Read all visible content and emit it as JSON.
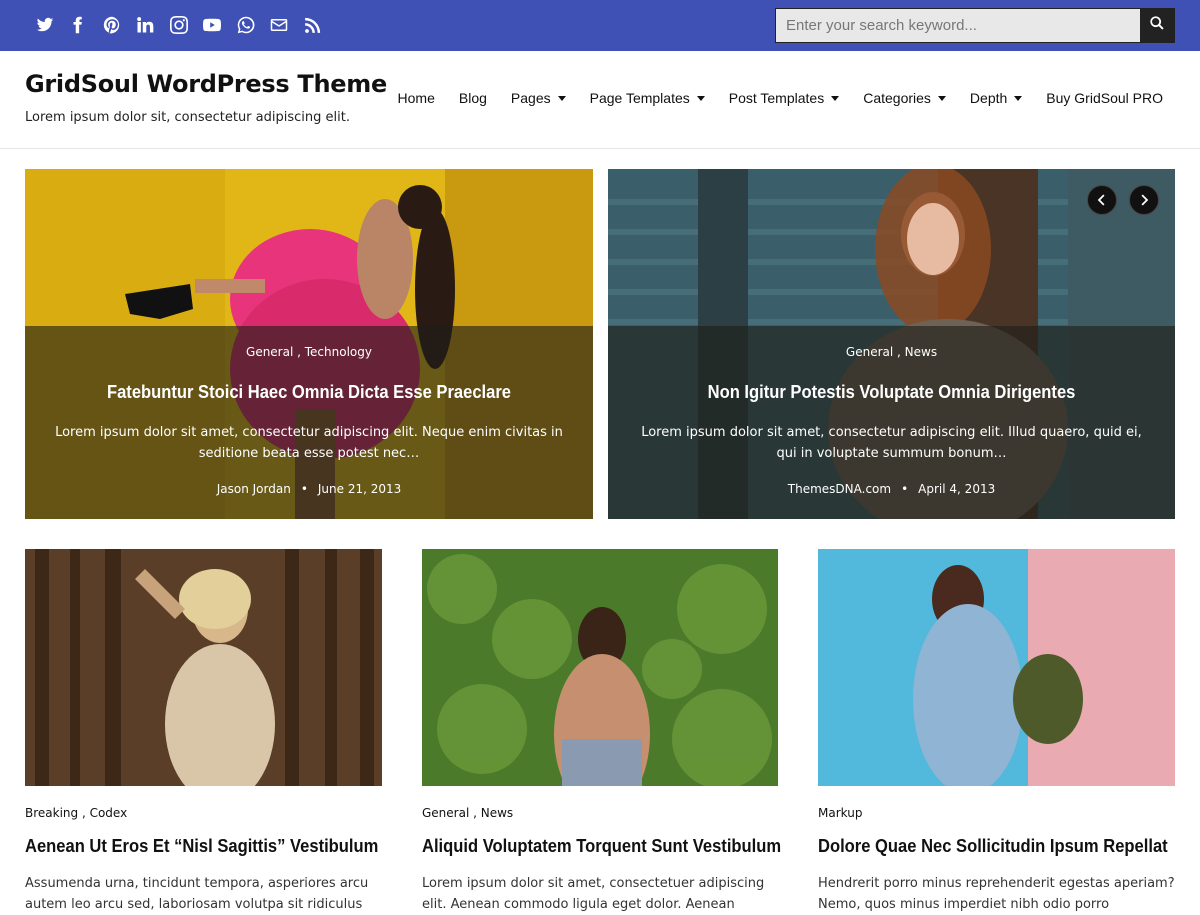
{
  "colors": {
    "topbar": "#3f51b5",
    "accent": "#111111"
  },
  "social_icons": [
    "twitter-icon",
    "facebook-icon",
    "pinterest-icon",
    "linkedin-icon",
    "instagram-icon",
    "youtube-icon",
    "whatsapp-icon",
    "email-icon",
    "rss-icon"
  ],
  "search": {
    "placeholder": "Enter your search keyword..."
  },
  "site": {
    "title": "GridSoul WordPress Theme",
    "description": "Lorem ipsum dolor sit, consectetur adipiscing elit."
  },
  "nav": {
    "items": [
      {
        "label": "Home",
        "dropdown": false
      },
      {
        "label": "Blog",
        "dropdown": false
      },
      {
        "label": "Pages",
        "dropdown": true
      },
      {
        "label": "Page Templates",
        "dropdown": true
      },
      {
        "label": "Post Templates",
        "dropdown": true
      },
      {
        "label": "Categories",
        "dropdown": true
      },
      {
        "label": "Depth",
        "dropdown": true
      },
      {
        "label": "Buy GridSoul PRO",
        "dropdown": false
      }
    ]
  },
  "slider": {
    "slides": [
      {
        "categories": "General , Technology",
        "title": "Fatebuntur Stoici Haec Omnia Dicta Esse Praeclare",
        "excerpt": "Lorem ipsum dolor sit amet, consectetur adipiscing elit. Neque enim civitas in seditione beata esse potest nec…",
        "author": "Jason Jordan",
        "date": "June 21, 2013"
      },
      {
        "categories": "General , News",
        "title": "Non Igitur Potestis Voluptate Omnia Dirigentes",
        "excerpt": "Lorem ipsum dolor sit amet, consectetur adipiscing elit. Illud quaero, quid ei, qui in voluptate summum bonum…",
        "author": "ThemesDNA.com",
        "date": "April 4, 2013"
      }
    ],
    "separator": "•"
  },
  "posts": [
    {
      "categories": "Breaking , Codex",
      "title": "Aenean Ut Eros Et “Nisl Sagittis” Vestibulum",
      "excerpt": "Assumenda urna, tincidunt tempora, asperiores arcu autem leo arcu sed, laboriosam volutpa sit ridiculus"
    },
    {
      "categories": "General , News",
      "title": "Aliquid Voluptatem Torquent Sunt Vestibulum",
      "excerpt": "Lorem ipsum dolor sit amet, consectetuer adipiscing elit. Aenean commodo ligula eget dolor. Aenean"
    },
    {
      "categories": "Markup",
      "title": "Dolore Quae Nec Sollicitudin Ipsum Repellat",
      "excerpt": "Hendrerit porro minus reprehenderit egestas aperiam? Nemo, quos minus imperdiet nibh odio porro"
    }
  ]
}
